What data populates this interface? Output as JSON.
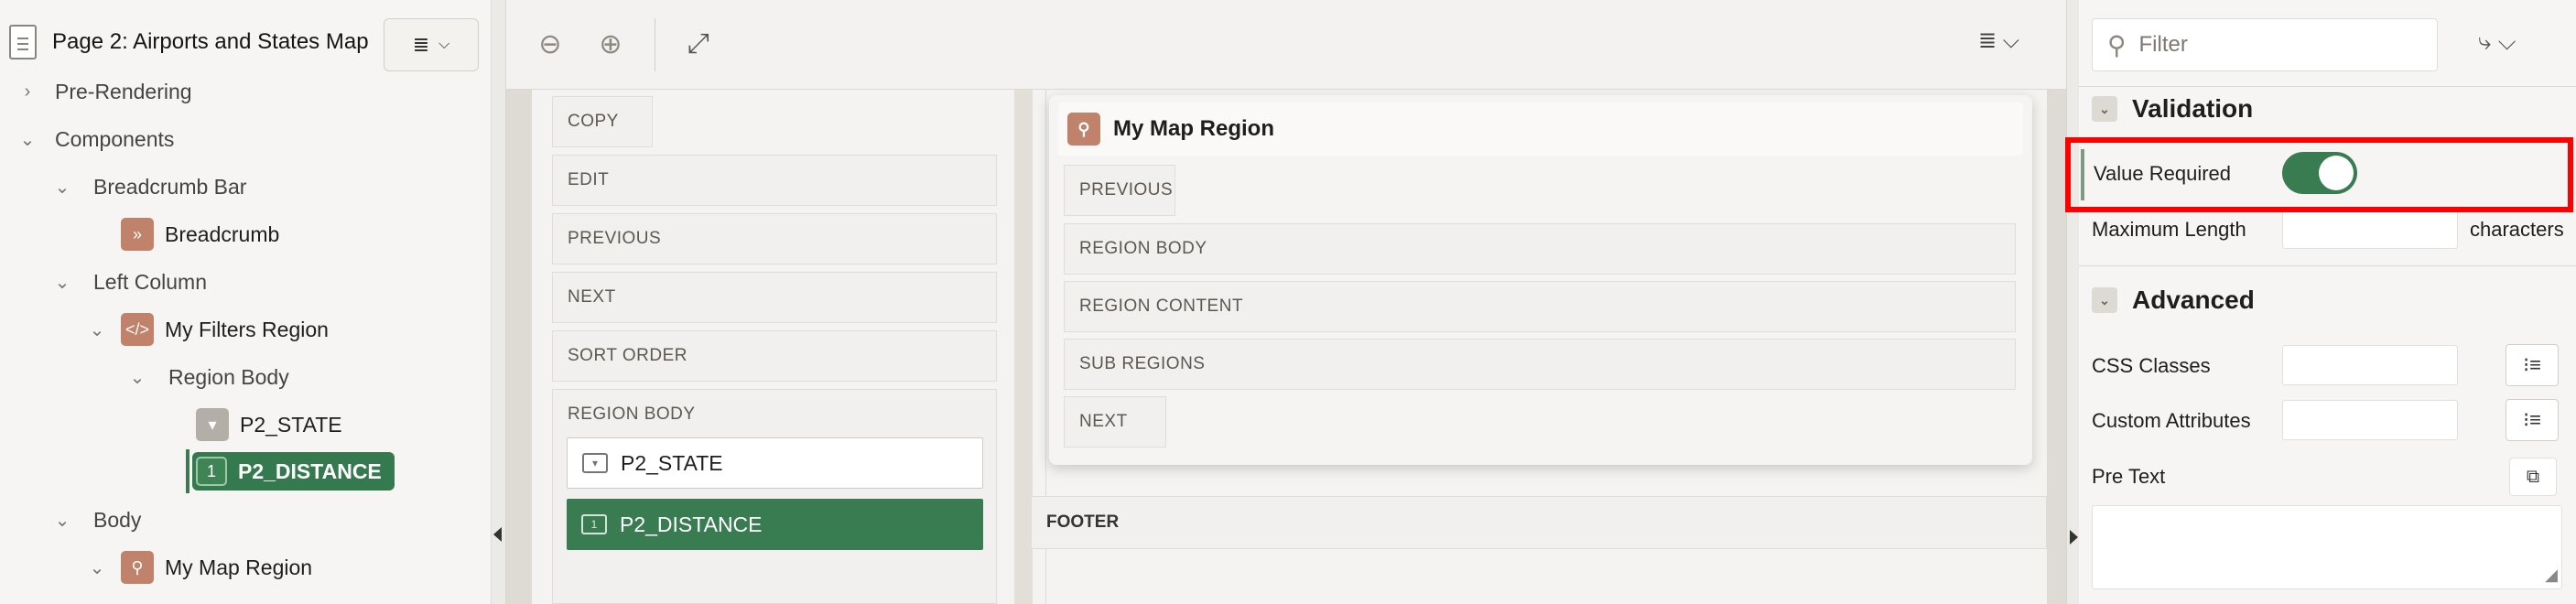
{
  "tree": {
    "page_title": "Page 2: Airports and States Map",
    "nodes": [
      {
        "label": "Pre-Rendering"
      },
      {
        "label": "Components"
      },
      {
        "label": "Breadcrumb Bar"
      },
      {
        "label": "Breadcrumb"
      },
      {
        "label": "Left Column"
      },
      {
        "label": "My Filters Region"
      },
      {
        "label": "Region Body"
      },
      {
        "label": "P2_STATE"
      },
      {
        "label": "P2_DISTANCE"
      },
      {
        "label": "Body"
      },
      {
        "label": "My Map Region"
      }
    ]
  },
  "layout": {
    "left_positions": [
      "COPY",
      "EDIT",
      "PREVIOUS",
      "NEXT",
      "SORT ORDER",
      "REGION BODY"
    ],
    "items": [
      "P2_STATE",
      "P2_DISTANCE"
    ],
    "map_region": {
      "title": "My Map Region",
      "positions": [
        "PREVIOUS",
        "REGION BODY",
        "REGION CONTENT",
        "SUB REGIONS",
        "NEXT"
      ]
    },
    "footer": "FOOTER"
  },
  "props": {
    "filter_placeholder": "Filter",
    "validation": {
      "title": "Validation",
      "value_required_label": "Value Required",
      "value_required": true,
      "max_length_label": "Maximum Length",
      "max_length_unit": "characters"
    },
    "advanced": {
      "title": "Advanced",
      "css_classes_label": "CSS Classes",
      "custom_attributes_label": "Custom Attributes",
      "pre_text_label": "Pre Text"
    }
  },
  "colors": {
    "accent_green": "#3a7c52",
    "icon_orange": "#c0826a",
    "highlight_red": "#ff0000"
  }
}
